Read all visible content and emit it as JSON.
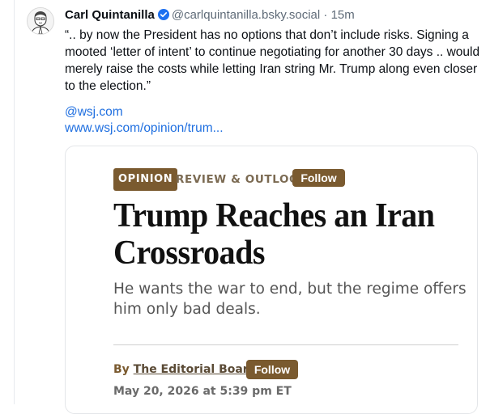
{
  "post": {
    "author_name": "Carl Quintanilla",
    "handle": "@carlquintanilla.bsky.social",
    "separator": "·",
    "time": "15m",
    "text": "“..  by now the President has no options that don’t include risks. Signing a mooted ‘letter of intent’ to continue negotiating for another 30 days .. would merely raise the costs while letting Iran string Mr. Trump along even closer to the election.”",
    "links": [
      "@wsj.com",
      "www.wsj.com/opinion/trum..."
    ]
  },
  "icons": {
    "avatar": "avatar-portrait",
    "verified": "verified-badge-icon"
  },
  "colors": {
    "link": "#1f6fe0",
    "wsj_accent": "#7a5a2f",
    "verified": "#1d70f0"
  },
  "card": {
    "section_badge": "OPINION",
    "kicker": "REVIEW & OUTLOOK",
    "follow_label": "Follow",
    "headline": "Trump Reaches an Iran Crossroads",
    "subhead": "He wants the war to end, but the regime offers him only bad deals.",
    "byline_prefix": "By",
    "byline_author": "The Editorial Board",
    "byline_follow_label": "Follow",
    "dateline": "May 20, 2026 at 5:39 pm ET"
  }
}
